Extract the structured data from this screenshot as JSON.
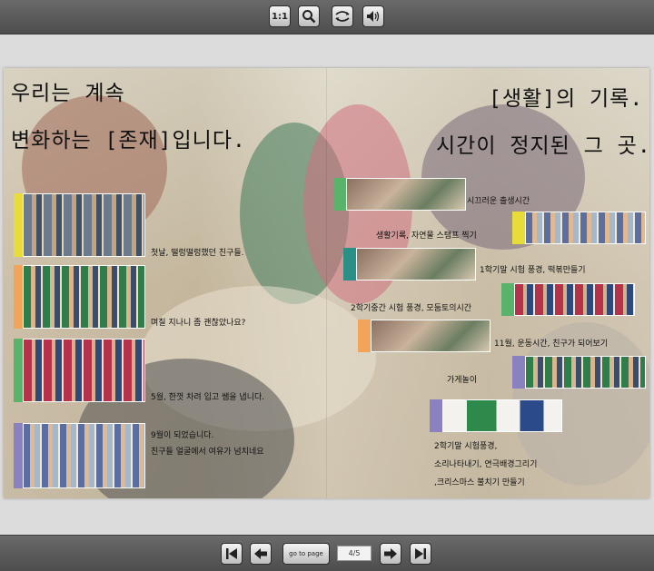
{
  "toolbar": {
    "actual_size_label": "1:1",
    "icons": [
      "actual-size-icon",
      "zoom-icon",
      "flip-icon",
      "sound-icon"
    ]
  },
  "left_page": {
    "title_line1": "우리는 계속",
    "title_line2": "변화하는 [존재]입니다.",
    "captions": [
      "첫날, 떨렁떨렁했던 친구들.",
      "며칠 지나니 좀 괜찮았나요?",
      "5월, 한껏 차려 입고 쌤을 냅니다.",
      "9월이 되었습니다.",
      "친구들 얼굴에서 여유가 넘치네요"
    ]
  },
  "right_page": {
    "title_line1": "[생활]의 기록.",
    "title_line2": "시간이 정지된 그 곳.",
    "captions": [
      "시끄러운 출생시간",
      "생활기록, 자연물 스탬프 찍기",
      "1학기말 시험 풍경, 떡볶만들기",
      "2학기중간 시험 풍경, 모둠토의시간",
      "11월, 운동시간, 친구가 되어보기",
      "가게놀이",
      "2학기말 시험풍경,",
      "소리나타내기, 연극배경그리기",
      ",크리스마스 불치기 만들기"
    ]
  },
  "nav": {
    "goto_label": "go to page",
    "page_indicator": "4/5"
  },
  "colors": {
    "yellow": "#e8dc3a",
    "orange": "#f2a55a",
    "green": "#5ab36a",
    "purple": "#8a82c0",
    "teal": "#2a8f85"
  }
}
